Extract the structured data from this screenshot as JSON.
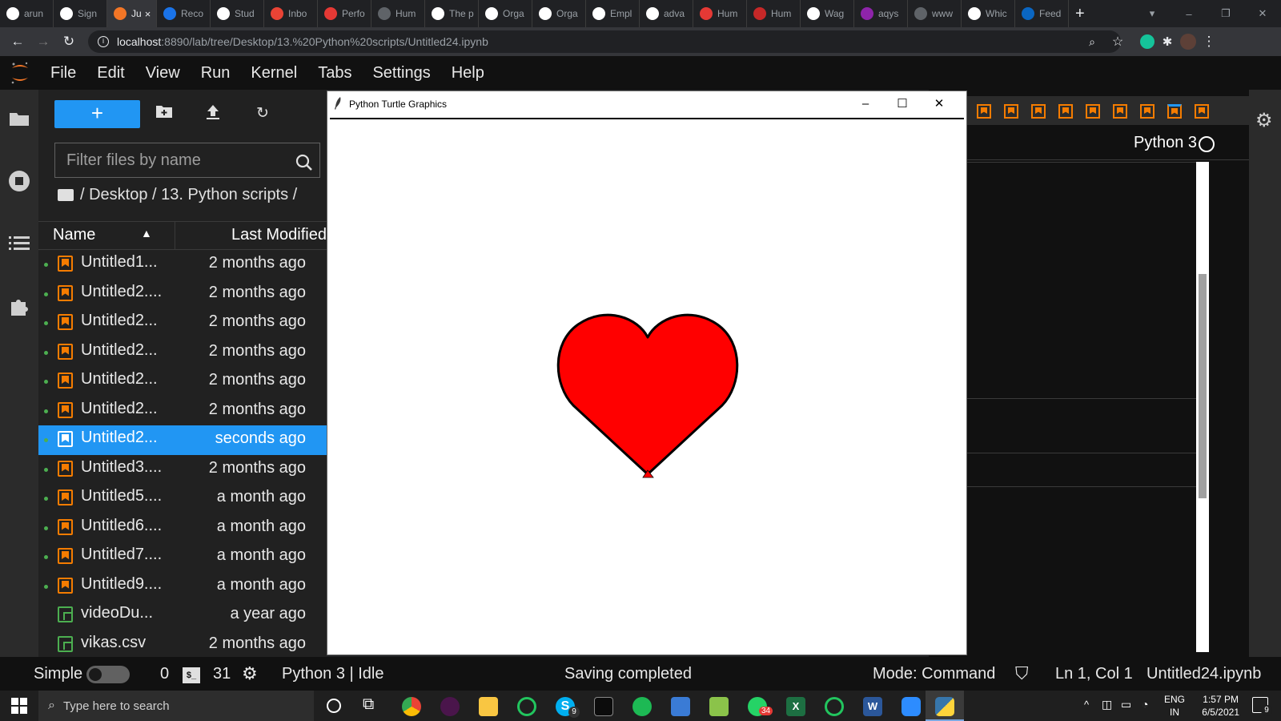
{
  "browser": {
    "tabs": [
      {
        "label": "arun",
        "icon": "github-icon",
        "color": "#ffffff"
      },
      {
        "label": "Sign",
        "icon": "google-icon",
        "color": "#ffffff"
      },
      {
        "label": "Ju",
        "icon": "jupyter-icon",
        "color": "#f37626",
        "active": true
      },
      {
        "label": "Reco",
        "icon": "reco-icon",
        "color": "#1a73e8"
      },
      {
        "label": "Stud",
        "icon": "stud-icon",
        "color": "#ffffff"
      },
      {
        "label": "Inbo",
        "icon": "gmail-icon",
        "color": "#ea4335"
      },
      {
        "label": "Perfo",
        "icon": "c-icon",
        "color": "#e53935"
      },
      {
        "label": "Hum",
        "icon": "globe-icon",
        "color": "#5f6368"
      },
      {
        "label": "The p",
        "icon": "e-icon",
        "color": "#ffffff"
      },
      {
        "label": "Orga",
        "icon": "google-icon",
        "color": "#ffffff"
      },
      {
        "label": "Orga",
        "icon": "google-icon",
        "color": "#ffffff"
      },
      {
        "label": "Empl",
        "icon": "google-icon",
        "color": "#ffffff"
      },
      {
        "label": "adva",
        "icon": "google-icon",
        "color": "#ffffff"
      },
      {
        "label": "Hum",
        "icon": "c-icon",
        "color": "#e53935"
      },
      {
        "label": "Hum",
        "icon": "hum-icon",
        "color": "#c62828"
      },
      {
        "label": "Wag",
        "icon": "google-icon",
        "color": "#ffffff"
      },
      {
        "label": "aqys",
        "icon": "hat-icon",
        "color": "#8e24aa"
      },
      {
        "label": "www",
        "icon": "globe-icon",
        "color": "#5f6368"
      },
      {
        "label": "Whic",
        "icon": "google-icon",
        "color": "#ffffff"
      },
      {
        "label": "Feed",
        "icon": "linkedin-icon",
        "color": "#0a66c2"
      }
    ],
    "tab_close": "×",
    "new_tab": "+",
    "url_host": "localhost",
    "url_path": ":8890/lab/tree/Desktop/13.%20Python%20scripts/Untitled24.ipynb"
  },
  "menubar": {
    "items": [
      "File",
      "Edit",
      "View",
      "Run",
      "Kernel",
      "Tabs",
      "Settings",
      "Help"
    ]
  },
  "filebrowser": {
    "new_label": "+",
    "filter_placeholder": "Filter files by name",
    "breadcrumb": "/ Desktop / 13. Python scripts /",
    "col_name": "Name",
    "col_modified": "Last Modified",
    "sort_arrow": "▲",
    "files": [
      {
        "name": "Untitled1...",
        "modified": "2 months ago",
        "running": true,
        "type": "notebook"
      },
      {
        "name": "Untitled2....",
        "modified": "2 months ago",
        "running": true,
        "type": "notebook"
      },
      {
        "name": "Untitled2...",
        "modified": "2 months ago",
        "running": true,
        "type": "notebook"
      },
      {
        "name": "Untitled2...",
        "modified": "2 months ago",
        "running": true,
        "type": "notebook"
      },
      {
        "name": "Untitled2...",
        "modified": "2 months ago",
        "running": true,
        "type": "notebook"
      },
      {
        "name": "Untitled2...",
        "modified": "2 months ago",
        "running": true,
        "type": "notebook"
      },
      {
        "name": "Untitled2...",
        "modified": "seconds ago",
        "running": true,
        "type": "notebook",
        "selected": true
      },
      {
        "name": "Untitled3....",
        "modified": "2 months ago",
        "running": true,
        "type": "notebook"
      },
      {
        "name": "Untitled5....",
        "modified": "a month ago",
        "running": true,
        "type": "notebook"
      },
      {
        "name": "Untitled6....",
        "modified": "a month ago",
        "running": true,
        "type": "notebook"
      },
      {
        "name": "Untitled7....",
        "modified": "a month ago",
        "running": true,
        "type": "notebook"
      },
      {
        "name": "Untitled9....",
        "modified": "a month ago",
        "running": true,
        "type": "notebook"
      },
      {
        "name": "videoDu...",
        "modified": "a year ago",
        "running": false,
        "type": "csv"
      },
      {
        "name": "vikas.csv",
        "modified": "2 months ago",
        "running": false,
        "type": "csv"
      }
    ]
  },
  "notebook": {
    "kernel_label": "Python 3"
  },
  "turtle_window": {
    "title": "Python Turtle Graphics",
    "minimize": "–",
    "maximize": "☐",
    "close": "✕",
    "heart_fill": "#ff0000",
    "heart_stroke": "#000000"
  },
  "statusbar": {
    "mode_simple": "Simple",
    "terminals_count": "0",
    "kernels_count": "31",
    "kernel_status": "Python 3 | Idle",
    "save_status": "Saving completed",
    "mode": "Mode: Command",
    "cursor_pos": "Ln 1, Col 1",
    "filename": "Untitled24.ipynb"
  },
  "taskbar": {
    "search_placeholder": "Type here to search",
    "lang_line1": "ENG",
    "lang_line2": "IN",
    "time": "1:57 PM",
    "date": "6/5/2021",
    "notification_count": "9",
    "whatsapp_badge": "34",
    "skype_badge": "9"
  },
  "colors": {
    "accent": "#2196f3",
    "notebook_icon": "#f57c00",
    "running_dot": "#4caf50"
  }
}
